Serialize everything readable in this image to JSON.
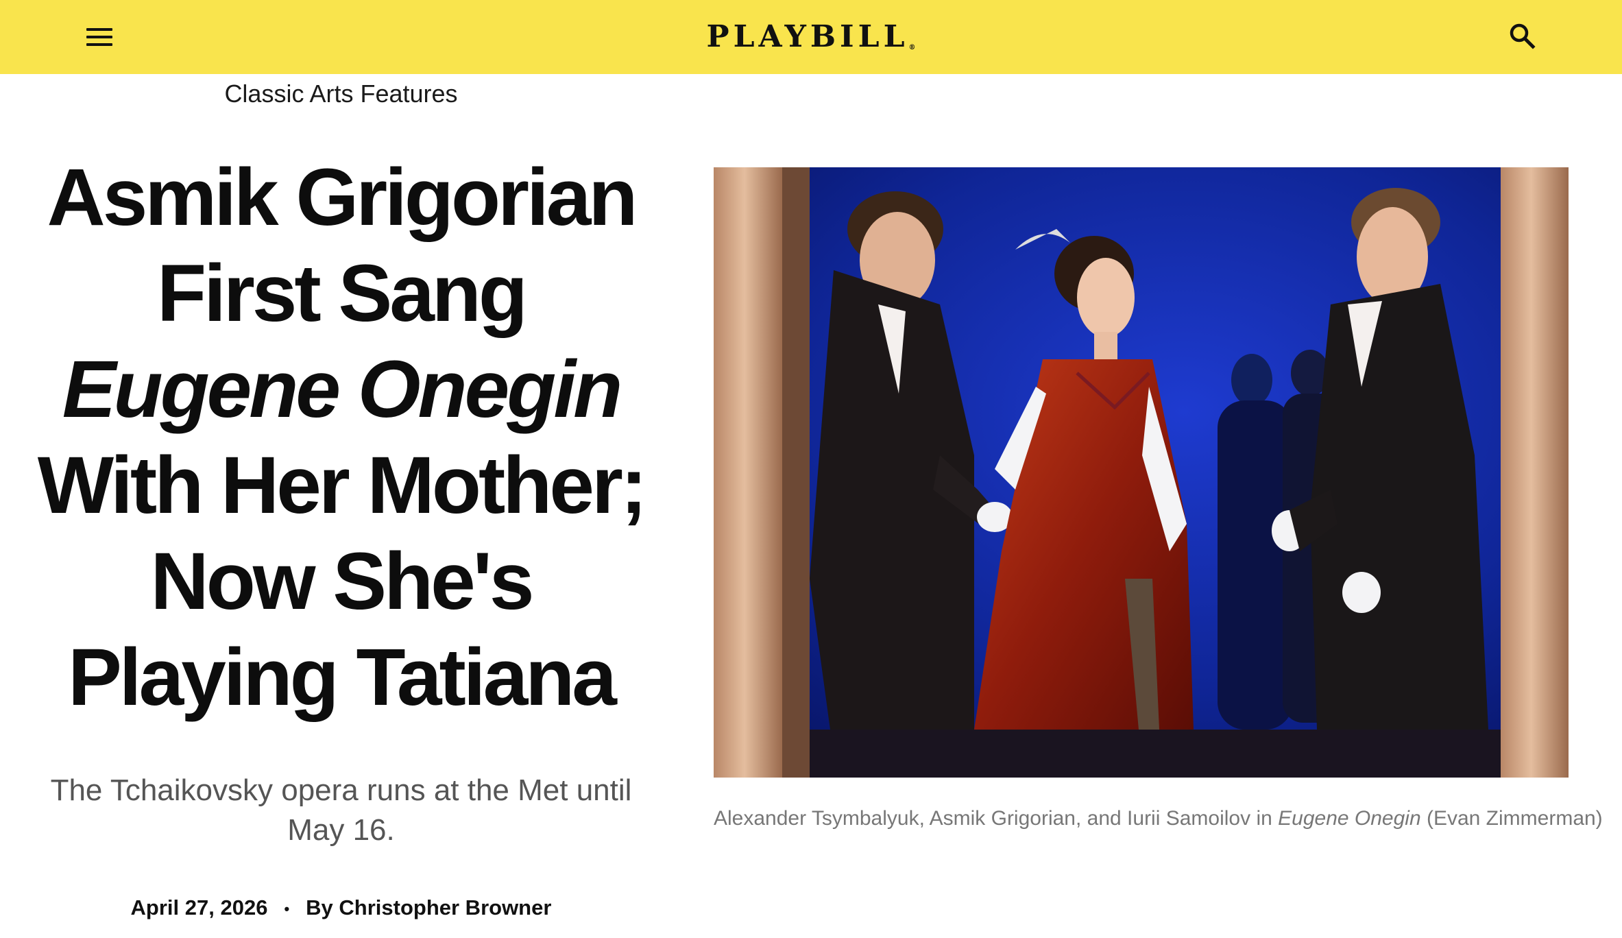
{
  "header": {
    "logo": "PLAYBILL",
    "logo_mark": "®",
    "menu_icon": "hamburger-menu-icon",
    "search_icon": "search-icon",
    "background_color": "#f9e44d"
  },
  "article": {
    "category": "Classic Arts Features",
    "headline_lines": [
      "Asmik Grigorian",
      "First Sang",
      "Eugene Onegin",
      "With Her Mother;",
      "Now She's",
      "Playing Tatiana"
    ],
    "subheadline": "The Tchaikovsky opera runs at the Met until May 16.",
    "date": "April 27, 2026",
    "separator": "•",
    "author": "By Christopher Browner"
  },
  "photo": {
    "caption_before": "Alexander Tsymbalyuk, Asmik Grigorian, and Iurii Samoilov in ",
    "caption_title": "Eugene Onegin",
    "caption_after": " (Evan Zimmerman)"
  }
}
